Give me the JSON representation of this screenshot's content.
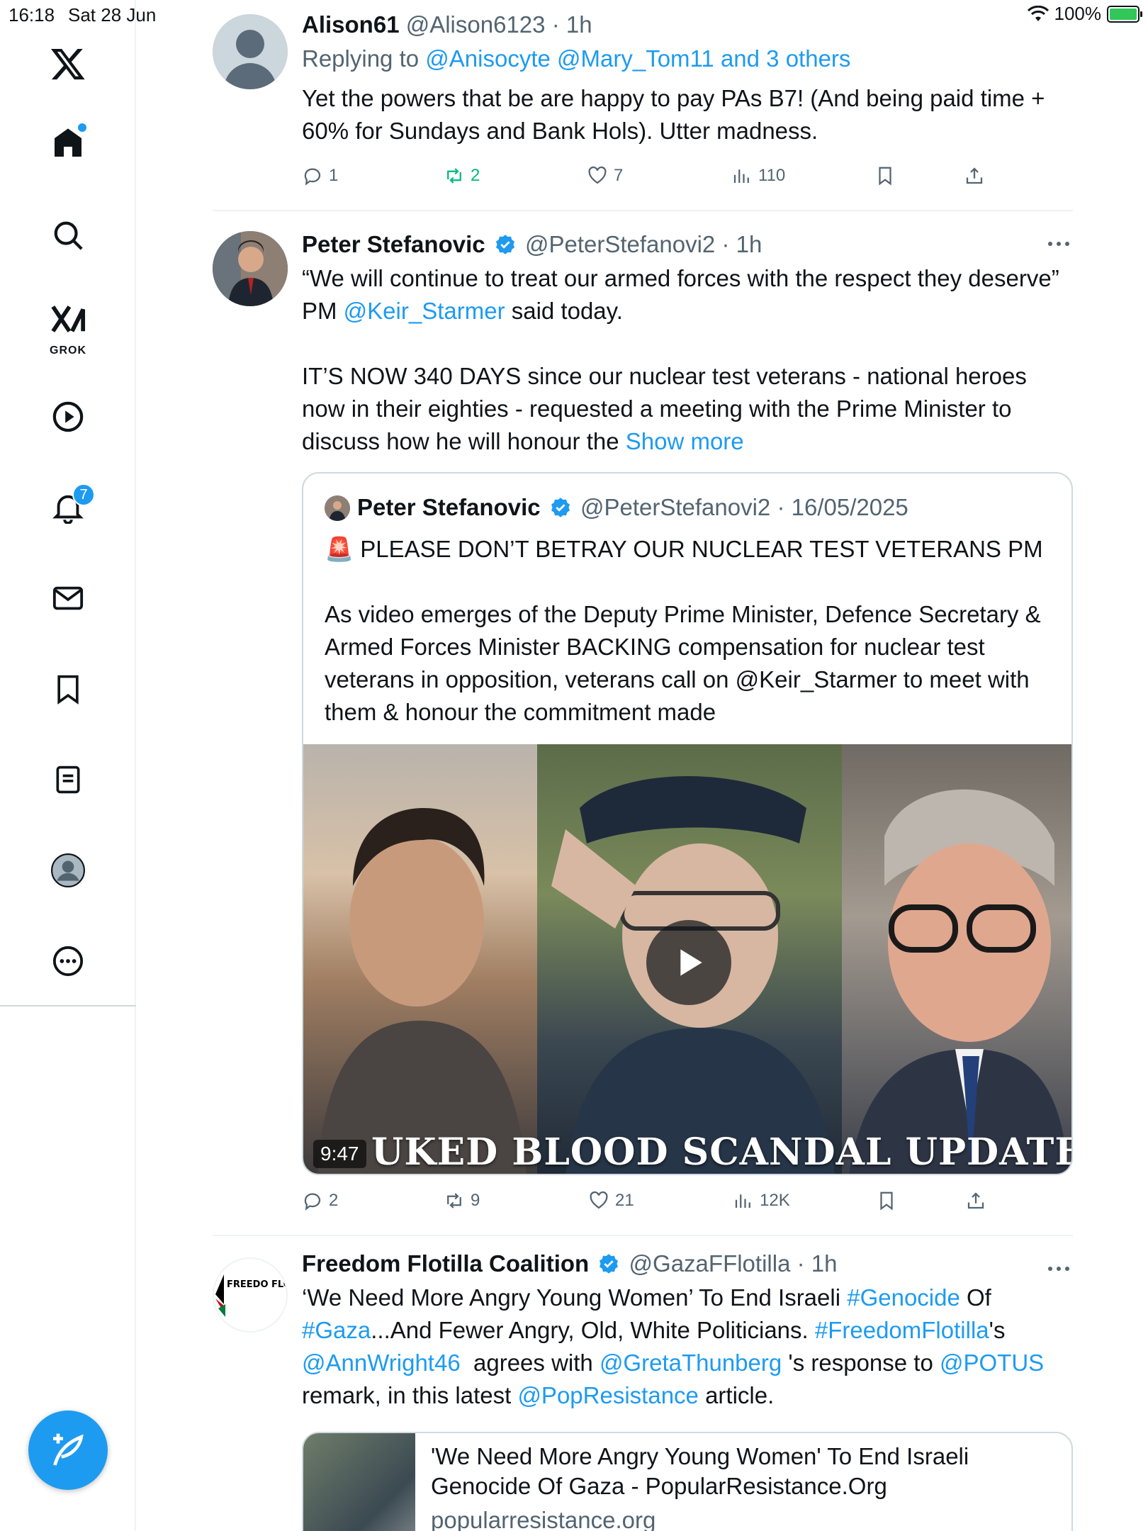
{
  "status_bar": {
    "time": "16:18",
    "date": "Sat 28 Jun",
    "battery": "100%"
  },
  "sidebar": {
    "grok_label": "GROK",
    "notifications_badge": "7"
  },
  "tweets": [
    {
      "name": "Alison61",
      "handle": "@Alison6123",
      "time": "· 1h",
      "replying_prefix": "Replying to ",
      "replying_to": "@Anisocyte @Mary_Tom11 and 3 others",
      "text": "Yet the powers that be are happy to pay PAs B7! (And being paid time + 60% for Sundays and Bank Hols). Utter madness.",
      "replies": "1",
      "reposts": "2",
      "likes": "7",
      "views": "110"
    },
    {
      "name": "Peter Stefanovic",
      "handle": "@PeterStefanovi2",
      "time": "· 1h",
      "text_1": "“We will continue to treat our armed forces with the respect they deserve” PM ",
      "mention": "@Keir_Starmer",
      "text_2": " said today.\n\nIT’S NOW 340 DAYS since our nuclear test veterans - national heroes now in their eighties - requested a meeting with the Prime Minister to discuss how he will honour the ",
      "show_more": "Show more",
      "quote": {
        "name": "Peter Stefanovic",
        "handle": "@PeterStefanovi2",
        "date": "· 16/05/2025",
        "text": "🚨 PLEASE DON’T BETRAY OUR NUCLEAR TEST VETERANS PM\n\nAs video emerges of the Deputy Prime Minister, Defence Secretary & Armed Forces Minister BACKING compensation for nuclear test veterans in opposition, veterans call on @Keir_Starmer to meet with them & honour the commitment made",
        "video_duration": "9:47",
        "video_overlay": "UKED BLOOD SCANDAL UPDATE"
      },
      "replies": "2",
      "reposts": "9",
      "likes": "21",
      "views": "12K"
    },
    {
      "name": "Freedom Flotilla Coalition",
      "handle": "@GazaFFlotilla",
      "time": "· 1h",
      "avatar_text": "FREEDO FLOTILL COALITI",
      "t1": "‘We Need More Angry Young Women’ To End Israeli ",
      "h1": "#Genocide",
      "t2": " Of ",
      "h2": "#Gaza",
      "t3": "...And Fewer Angry, Old, White Politicians. ",
      "h3": "#FreedomFlotilla",
      "t4": "'s  ",
      "m1": "@AnnWright46",
      "t5": "  agrees with ",
      "m2": "@GretaThunberg",
      "t6": " 's response to ",
      "m3": "@POTUS",
      "t7": " remark, in this latest ",
      "m4": "@PopResistance",
      "t8": " article.",
      "card": {
        "title": "'We Need More Angry Young Women' To End Israeli Genocide Of Gaza - PopularResistance.Org",
        "domain": "popularresistance.org"
      }
    }
  ],
  "colors": {
    "accent": "#1d9bf0",
    "repost_green": "#00ba7c",
    "text": "#0f1419",
    "secondary": "#536471"
  }
}
